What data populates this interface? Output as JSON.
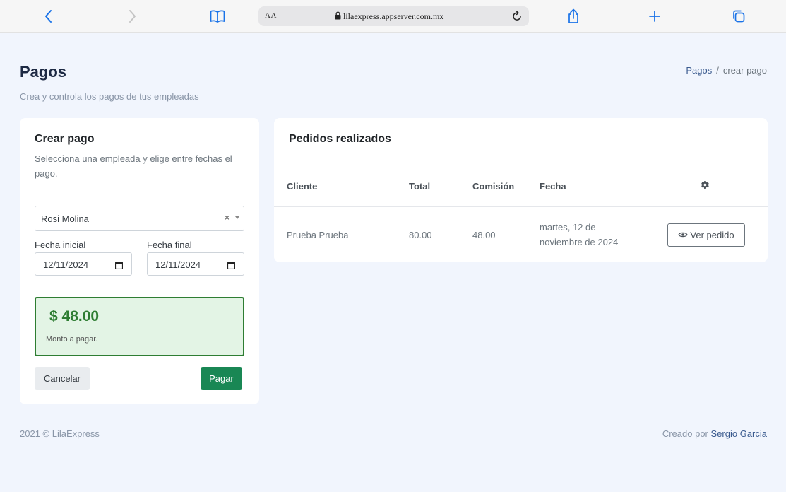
{
  "browser": {
    "text_size_label": "AA",
    "url": "lilaexpress.appserver.com.mx"
  },
  "colors": {
    "accent": "#1a73e8",
    "success": "#198754",
    "amount_text": "#2e7d32",
    "page_bg": "#f1f5fd"
  },
  "page": {
    "title": "Pagos",
    "subtitle": "Crea y controla los pagos de tus empleadas",
    "breadcrumb": {
      "link": "Pagos",
      "separator": "/",
      "current": "crear pago"
    }
  },
  "create_payment": {
    "title": "Crear pago",
    "description": "Selecciona una empleada y elige entre fechas el pago.",
    "employee_select": {
      "value": "Rosi Molina",
      "clear_symbol": "×"
    },
    "start_date": {
      "label": "Fecha inicial",
      "value": "12/11/2024"
    },
    "end_date": {
      "label": "Fecha final",
      "value": "12/11/2024"
    },
    "amount": {
      "value": "$ 48.00",
      "label": "Monto a pagar."
    },
    "cancel_label": "Cancelar",
    "pay_label": "Pagar"
  },
  "orders": {
    "title": "Pedidos realizados",
    "columns": [
      "Cliente",
      "Total",
      "Comisión",
      "Fecha"
    ],
    "rows": [
      {
        "client": "Prueba Prueba",
        "total": "80.00",
        "commission": "48.00",
        "date_line1": "martes, 12 de",
        "date_line2": "noviembre de 2024",
        "action": "Ver pedido"
      }
    ]
  },
  "footer": {
    "copyright": "2021 © LilaExpress",
    "credit_prefix": "Creado por",
    "credit_name": "Sergio Garcia"
  }
}
